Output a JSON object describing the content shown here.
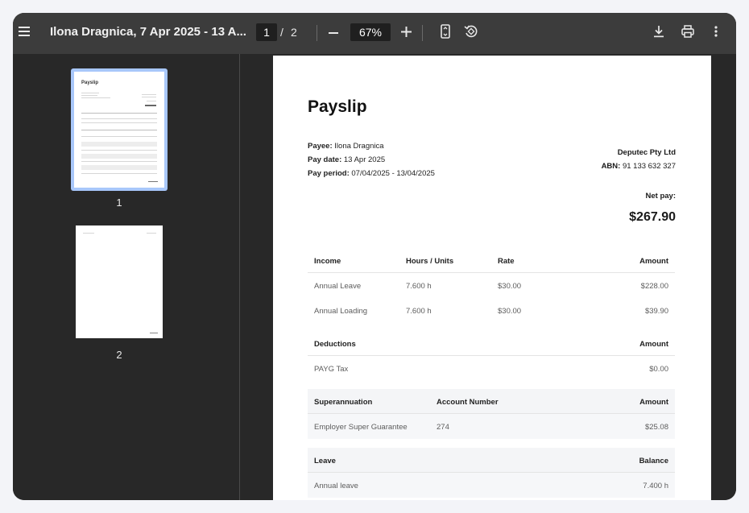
{
  "toolbar": {
    "menu_icon": "hamburger-icon",
    "title": "Ilona Dragnica, 7 Apr 2025 - 13 A...",
    "current_page": "1",
    "page_separator": "/",
    "total_pages": "2",
    "zoom_out_icon": "minus-icon",
    "zoom_level": "67%",
    "zoom_in_icon": "plus-icon",
    "fit_icon": "fit-page-icon",
    "rotate_icon": "rotate-icon",
    "download_icon": "download-icon",
    "print_icon": "print-icon",
    "more_icon": "more-vert-icon"
  },
  "thumbnails": [
    {
      "label": "1",
      "selected": true
    },
    {
      "label": "2",
      "selected": false
    }
  ],
  "document": {
    "heading": "Payslip",
    "payee_label": "Payee:",
    "payee_value": "Ilona Dragnica",
    "pay_date_label": "Pay date:",
    "pay_date_value": "13 Apr 2025",
    "pay_period_label": "Pay period:",
    "pay_period_value": "07/04/2025 - 13/04/2025",
    "company": "Deputec Pty Ltd",
    "abn_label": "ABN:",
    "abn_value": "91 133 632 327",
    "net_pay_label": "Net pay:",
    "net_pay_value": "$267.90",
    "income": {
      "headers": [
        "Income",
        "Hours / Units",
        "Rate",
        "Amount"
      ],
      "rows": [
        [
          "Annual Leave",
          "7.600 h",
          "$30.00",
          "$228.00"
        ],
        [
          "Annual Loading",
          "7.600 h",
          "$30.00",
          "$39.90"
        ]
      ]
    },
    "deductions": {
      "headers": [
        "Deductions",
        "Amount"
      ],
      "rows": [
        [
          "PAYG Tax",
          "$0.00"
        ]
      ]
    },
    "superannuation": {
      "headers": [
        "Superannuation",
        "Account Number",
        "Amount"
      ],
      "rows": [
        [
          "Employer Super Guarantee",
          "274",
          "$25.08"
        ]
      ]
    },
    "leave": {
      "headers": [
        "Leave",
        "Balance"
      ],
      "rows": [
        [
          "Annual leave",
          "7.400 h"
        ]
      ]
    }
  }
}
